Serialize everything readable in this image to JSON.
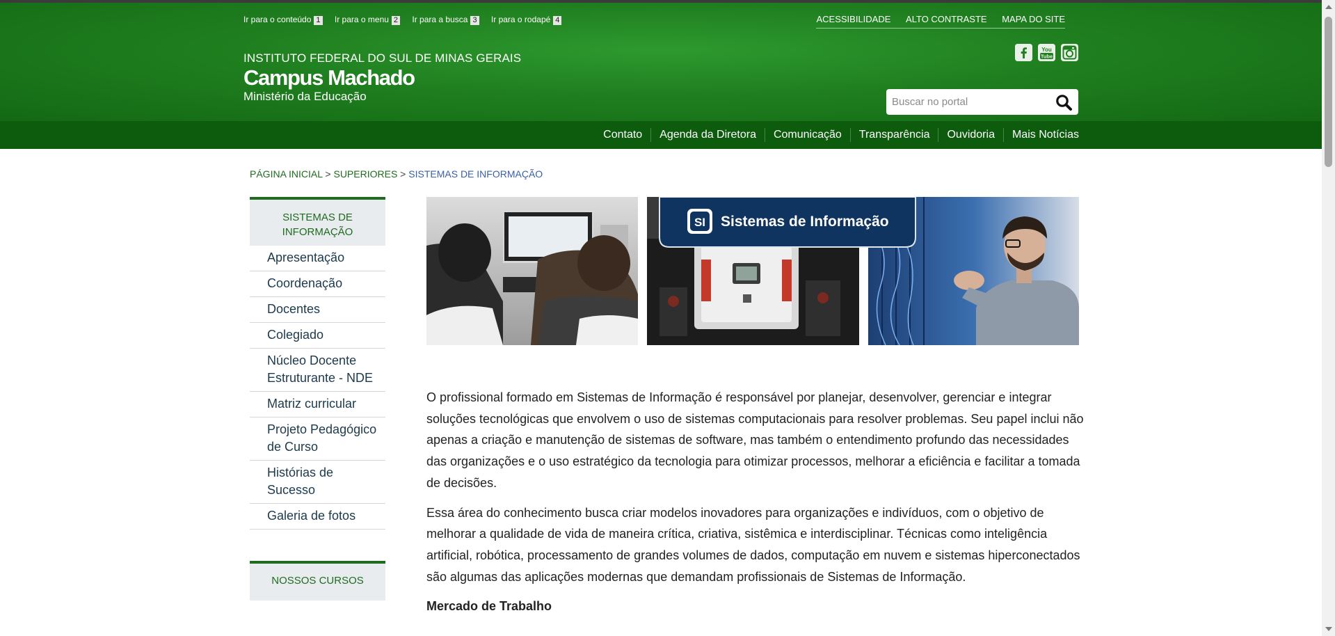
{
  "accessibility_bar": {
    "items": [
      {
        "label": "Ir para o conteúdo",
        "key": "1"
      },
      {
        "label": "Ir para o menu",
        "key": "2"
      },
      {
        "label": "Ir para a busca",
        "key": "3"
      },
      {
        "label": "Ir para o rodapé",
        "key": "4"
      }
    ]
  },
  "top_links": [
    "ACESSIBILIDADE",
    "ALTO CONTRASTE",
    "MAPA DO SITE"
  ],
  "brand": {
    "institution": "INSTITUTO FEDERAL DO SUL DE MINAS GERAIS",
    "campus": "Campus Machado",
    "ministry": "Ministério da Educação"
  },
  "social": {
    "facebook_icon": "facebook-icon",
    "youtube_icon": "youtube-icon",
    "instagram_icon": "instagram-icon"
  },
  "search": {
    "placeholder": "Buscar no portal",
    "icon": "search-icon"
  },
  "nav": [
    "Contato",
    "Agenda da Diretora",
    "Comunicação",
    "Transparência",
    "Ouvidoria",
    "Mais Notícias"
  ],
  "breadcrumb": {
    "home": "PÁGINA INICIAL",
    "separator": " > ",
    "section": "SUPERIORES",
    "current": "SISTEMAS DE INFORMAÇÃO"
  },
  "sidebar": {
    "heading": "SISTEMAS DE INFORMAÇÃO",
    "items": [
      "Apresentação",
      "Coordenação",
      "Docentes",
      "Colegiado",
      "Núcleo Docente Estruturante - NDE",
      "Matriz curricular",
      "Projeto Pedagógico de Curso",
      "Histórias de Sucesso",
      "Galeria de fotos"
    ],
    "heading2": "NOSSOS CURSOS"
  },
  "banner": {
    "title": "Sistemas de Informação",
    "logo_text": "SI"
  },
  "content": {
    "paragraph1": "O profissional formado em Sistemas de Informação é responsável por planejar, desenvolver, gerenciar e integrar soluções tecnológicas que envolvem o uso de sistemas computacionais para resolver problemas. Seu papel inclui não apenas a criação e manutenção de sistemas de software, mas também o entendimento profundo das necessidades das organizações e o uso estratégico da tecnologia para otimizar processos, melhorar a eficiência e facilitar a tomada de decisões.",
    "paragraph2": "Essa área do conhecimento busca criar modelos inovadores para organizações e indivíduos, com o objetivo de melhorar a qualidade de vida de maneira crítica, criativa, sistêmica e interdisciplinar. Técnicas como inteligência artificial, robótica, processamento de grandes volumes de dados, computação em nuvem e sistemas hiperconectados são algumas das aplicações modernas que demandam profissionais de Sistemas de Informação.",
    "heading": "Mercado de Trabalho"
  },
  "colors": {
    "header_green": "#1f7f1f",
    "nav_green": "#0d5b0d",
    "link_green": "#1f6b1f",
    "breadcrumb_current": "#3a5fa8"
  }
}
